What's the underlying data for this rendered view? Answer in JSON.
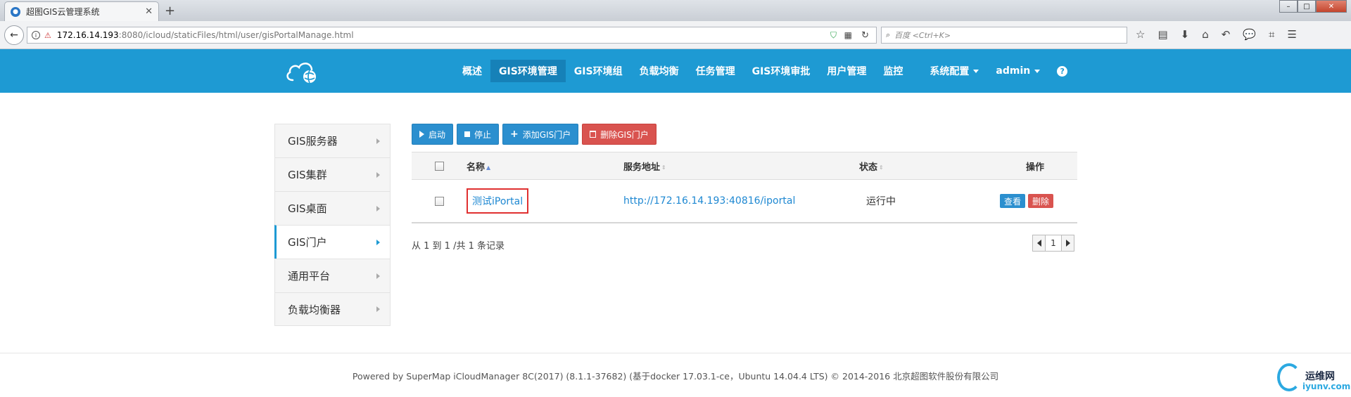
{
  "browser": {
    "tab_title": "超图GIS云管理系统",
    "tab_close": "✕",
    "new_tab": "+",
    "url_host": "172.16.14.193",
    "url_path": ":8080/icloud/staticFiles/html/user/gisPortalManage.html",
    "search_placeholder": "百度 <Ctrl+K>",
    "window_minimize": "–",
    "window_maximize": "□",
    "window_close": "✕"
  },
  "header": {
    "nav": [
      {
        "label": "概述"
      },
      {
        "label": "GIS环境管理"
      },
      {
        "label": "GIS环境组"
      },
      {
        "label": "负载均衡"
      },
      {
        "label": "任务管理"
      },
      {
        "label": "GIS环境审批"
      },
      {
        "label": "用户管理"
      },
      {
        "label": "监控"
      },
      {
        "label": "系统配置"
      },
      {
        "label": "admin"
      }
    ],
    "help": "?",
    "accent": "#1e9ad3"
  },
  "sidebar": {
    "items": [
      {
        "label": "GIS服务器"
      },
      {
        "label": "GIS集群"
      },
      {
        "label": "GIS桌面"
      },
      {
        "label": "GIS门户"
      },
      {
        "label": "通用平台"
      },
      {
        "label": "负载均衡器"
      }
    ],
    "active_index": 3
  },
  "toolbar": {
    "start": "启动",
    "stop": "停止",
    "add": "添加GIS门户",
    "delete": "删除GIS门户"
  },
  "table": {
    "headers": {
      "name": "名称",
      "address": "服务地址",
      "status": "状态",
      "ops": "操作"
    },
    "rows": [
      {
        "name": "测试iPortal",
        "address": "http://172.16.14.193:40816/iportal",
        "status": "运行中",
        "view": "查看",
        "delete": "删除"
      }
    ]
  },
  "records_text": "从 1 到 1 /共 1 条记录",
  "pager": {
    "current": "1"
  },
  "footer": {
    "text": "Powered by SuperMap iCloudManager 8C(2017) (8.1.1-37682) (基于docker 17.03.1-ce，Ubuntu 14.04.4 LTS) © 2014-2016 北京超图软件股份有限公司"
  },
  "watermark": {
    "title": "运维网",
    "sub": "iyunv.com"
  }
}
